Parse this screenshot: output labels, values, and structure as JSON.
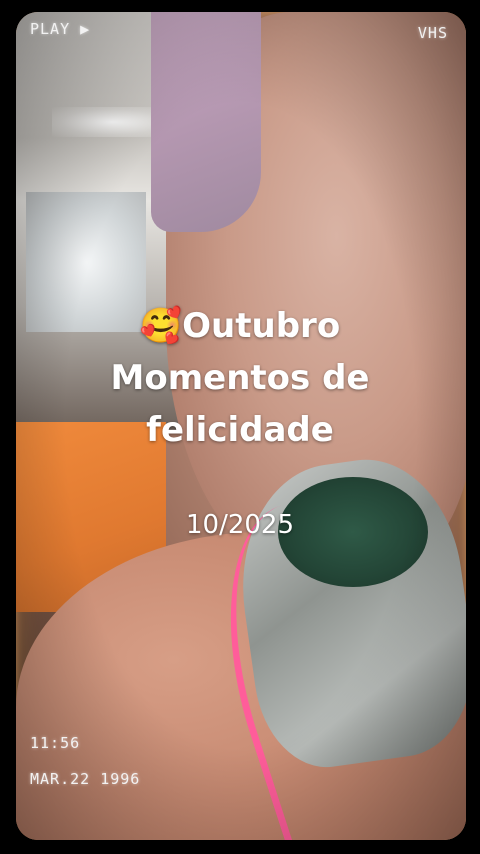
{
  "hud": {
    "play_label": "PLAY",
    "play_icon": "play-triangle-icon",
    "mode_label": "VHS",
    "time": "11:56",
    "date": "MAR.22 1996"
  },
  "overlay": {
    "emoji": "🥰",
    "title_line1": "Outubro",
    "title_line2": "Momentos de",
    "title_line3": "felicidade",
    "month_year": "10/2025"
  },
  "colors": {
    "frame_glow": "#ffb060",
    "strap_pink": "#ff5d9a",
    "shirt_orange": "#f08a3c"
  }
}
